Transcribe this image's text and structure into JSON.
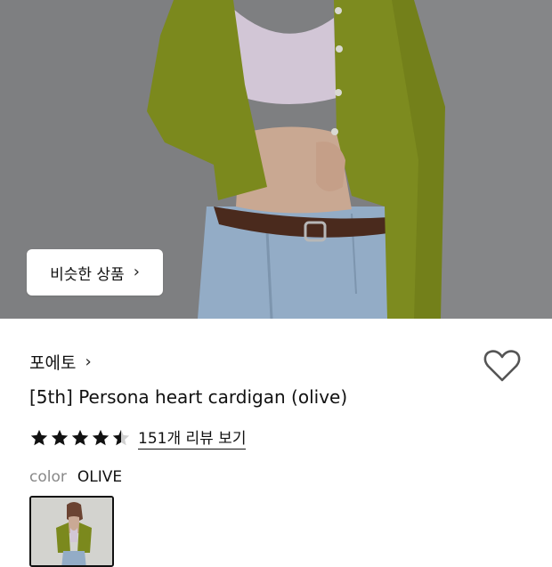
{
  "hero": {
    "similar_button_label": "비슷한 상품"
  },
  "product": {
    "brand": "포에토",
    "title": "[5th] Persona heart cardigan (olive)",
    "rating": 4.5,
    "review_link": "151개 리뷰 보기",
    "color_label": "color",
    "color_value": "OLIVE"
  },
  "colors": {
    "cardigan": "#7c8a1e",
    "denim": "#93acc6",
    "background": "#7d7e80"
  },
  "icons": [
    "chevron-right-icon",
    "heart-outline-icon",
    "star-icon"
  ]
}
